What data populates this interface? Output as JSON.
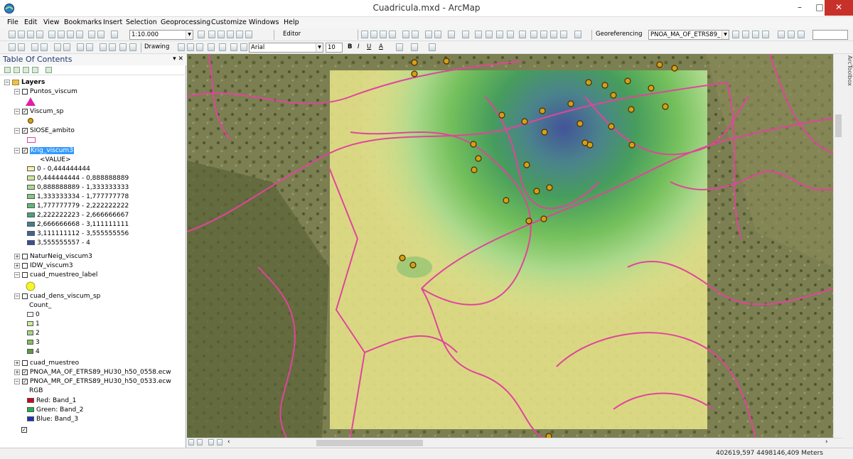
{
  "window": {
    "title": "Cuadricula.mxd - ArcMap",
    "minimize": "–",
    "maximize": "□",
    "close": "✕"
  },
  "menu": [
    "File",
    "Edit",
    "View",
    "Bookmarks",
    "Insert",
    "Selection",
    "Geoprocessing",
    "Customize",
    "Windows",
    "Help"
  ],
  "toolbar": {
    "scale": "1:10.000",
    "editor_label": "Editor",
    "georeferencing_label": "Georeferencing",
    "georef_layer": "PNOA_MA_OF_ETRS89_",
    "drawing_label": "Drawing",
    "font_name": "Arial",
    "font_size": "10",
    "bold": "B",
    "italic": "I",
    "underline": "U",
    "text_color": "A"
  },
  "toc": {
    "title": "Table Of Contents",
    "pin": "▾ ✕",
    "root": "Layers",
    "layers": [
      {
        "name": "Puntos_viscum",
        "checked": false,
        "expanded": true
      },
      {
        "name": "Viscum_sp",
        "checked": true,
        "expanded": true
      },
      {
        "name": "SIOSE_ambito",
        "checked": true,
        "expanded": true
      },
      {
        "name": "Krig_viscum3",
        "checked": true,
        "expanded": true,
        "selected": true
      },
      {
        "name": "NaturNeig_viscum3",
        "checked": false,
        "expanded": false
      },
      {
        "name": "IDW_viscum3",
        "checked": false,
        "expanded": false
      },
      {
        "name": "cuad_muestreo_label",
        "checked": false,
        "expanded": true
      },
      {
        "name": "cuad_dens_viscum_sp",
        "checked": false,
        "expanded": true
      },
      {
        "name": "cuad_muestreo",
        "checked": false,
        "expanded": false
      },
      {
        "name": "PNOA_MA_OF_ETRS89_HU30_h50_0558.ecw",
        "checked": true,
        "expanded": false
      },
      {
        "name": "PNOA_MR_OF_ETRS89_HU30_h50_0533.ecw",
        "checked": true,
        "expanded": true
      }
    ],
    "krig_field": "<VALUE>",
    "krig_classes": [
      {
        "label": "0 - 0,444444444",
        "color": "#f4f0a6"
      },
      {
        "label": "0,444444444 - 0,888888889",
        "color": "#cfe69a"
      },
      {
        "label": "0,888888889 - 1,333333333",
        "color": "#a9d98c"
      },
      {
        "label": "1,333333334 - 1,777777778",
        "color": "#84c97f"
      },
      {
        "label": "1,777777779 - 2,222222222",
        "color": "#5fb878"
      },
      {
        "label": "2,222222223 - 2,666666667",
        "color": "#4b9f7f"
      },
      {
        "label": "2,666666668 - 3,111111111",
        "color": "#437f8c"
      },
      {
        "label": "3,111111112 - 3,555555556",
        "color": "#3f6396"
      },
      {
        "label": "3,555555557 - 4",
        "color": "#3b4d9a"
      }
    ],
    "dens_field": "Count_",
    "dens_classes": [
      {
        "label": "0",
        "color": "#f5f5f5"
      },
      {
        "label": "1",
        "color": "#c8ec9a"
      },
      {
        "label": "2",
        "color": "#a5d97c"
      },
      {
        "label": "3",
        "color": "#85bd62"
      },
      {
        "label": "4",
        "color": "#5e9a44"
      }
    ],
    "rgb_label": "RGB",
    "bands": [
      {
        "label": "Red:   Band_1",
        "color": "#d0021b"
      },
      {
        "label": "Green: Band_2",
        "color": "#22b14c"
      },
      {
        "label": "Blue:  Band_3",
        "color": "#1f2fbf"
      }
    ]
  },
  "side_panel": {
    "label": "ArcToolbox"
  },
  "status": {
    "coordinates": "402619,597  4498146,409 Meters"
  },
  "colors": {
    "title_close": "#c7312a",
    "selection": "#3399ff",
    "polygon_outline": "#e0459b",
    "kriging_low": "#f4f0a6",
    "kriging_high": "#3b4d9a",
    "point_symbol": "#d4a017"
  }
}
